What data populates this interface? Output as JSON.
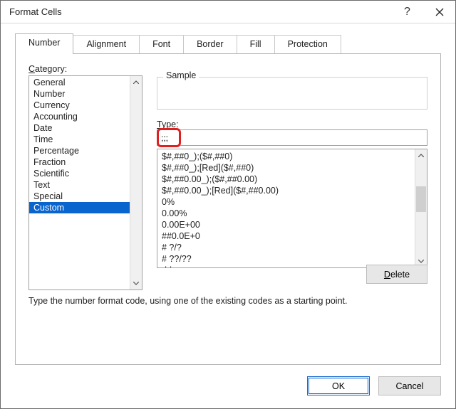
{
  "window": {
    "title": "Format Cells"
  },
  "tabs": [
    {
      "label": "Number",
      "active": true
    },
    {
      "label": "Alignment",
      "active": false
    },
    {
      "label": "Font",
      "active": false
    },
    {
      "label": "Border",
      "active": false
    },
    {
      "label": "Fill",
      "active": false
    },
    {
      "label": "Protection",
      "active": false
    }
  ],
  "category": {
    "label_pre": "C",
    "label_rest": "ategory:",
    "items": [
      "General",
      "Number",
      "Currency",
      "Accounting",
      "Date",
      "Time",
      "Percentage",
      "Fraction",
      "Scientific",
      "Text",
      "Special",
      "Custom"
    ],
    "selected_index": 11
  },
  "sample": {
    "label": "Sample",
    "value": ""
  },
  "type_field": {
    "label_pre": "T",
    "label_rest": "ype:",
    "value": ";;;"
  },
  "format_list": [
    "$#,##0_);($#,##0)",
    "$#,##0_);[Red]($#,##0)",
    "$#,##0.00_);($#,##0.00)",
    "$#,##0.00_);[Red]($#,##0.00)",
    "0%",
    "0.00%",
    "0.00E+00",
    "##0.0E+0",
    "# ?/?",
    "# ??/??",
    "dd-mm-yy"
  ],
  "delete_button": {
    "pre": "D",
    "rest": "elete"
  },
  "hint": "Type the number format code, using one of the existing codes as a starting point.",
  "footer": {
    "ok": "OK",
    "cancel": "Cancel"
  }
}
